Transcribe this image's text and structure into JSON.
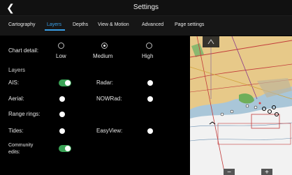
{
  "header": {
    "title": "Settings",
    "back_icon": "chevron-left-icon"
  },
  "tabs": [
    {
      "label": "Cartography",
      "active": false
    },
    {
      "label": "Layers",
      "active": true
    },
    {
      "label": "Depths",
      "active": false
    },
    {
      "label": "View & Motion",
      "active": false
    },
    {
      "label": "Advanced",
      "active": false
    },
    {
      "label": "Page settings",
      "active": false
    }
  ],
  "chart_detail": {
    "label": "Chart detail:",
    "options": [
      "Low",
      "Medium",
      "High"
    ],
    "selected": "Medium"
  },
  "layers": {
    "heading": "Layers",
    "items": {
      "ais": {
        "label": "AIS:",
        "on": true
      },
      "radar": {
        "label": "Radar:",
        "on": false
      },
      "aerial": {
        "label": "Aerial:",
        "on": false
      },
      "nowrad": {
        "label": "NOWRad:",
        "on": false
      },
      "range_rings": {
        "label": "Range rings:",
        "on": false
      },
      "tides": {
        "label": "Tides:",
        "on": false
      },
      "easyview": {
        "label": "EasyView:",
        "on": false
      },
      "community_edits": {
        "label": "Community\nedits:",
        "on": true
      }
    }
  },
  "map_controls": {
    "zoom_out": "−",
    "zoom_in": "+"
  },
  "colors": {
    "accent": "#3aa0e8",
    "toggle_on": "#3aa356",
    "land": "#e7c989",
    "water": "#a9c6d8"
  }
}
